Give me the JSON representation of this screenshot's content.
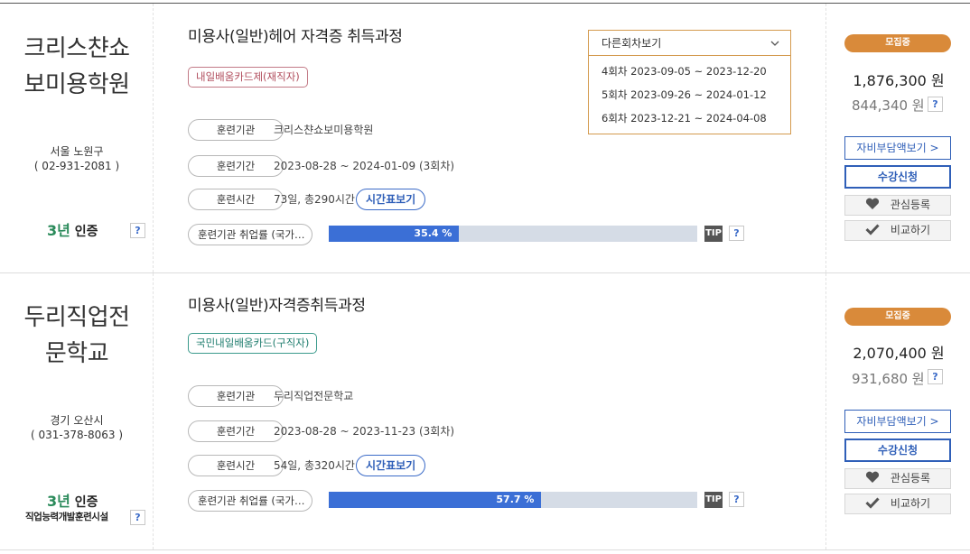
{
  "courses": [
    {
      "institution_lines": [
        "크리스챤쇼",
        "보미용학원"
      ],
      "location": "서울 노원구",
      "phone": "( 02-931-2081 )",
      "cert_years": "3년",
      "cert_label": "인증",
      "cert_sub": "",
      "title": "미용사(일반)헤어 자격증 취득과정",
      "card_type": "내일배움카드제(재직자)",
      "labels": {
        "institution": "훈련기관",
        "period": "훈련기간",
        "hours": "훈련시간",
        "employment": "훈련기관 취업률 (국가…"
      },
      "institution_value": "크리스챤쇼보미용학원",
      "period_value": "2023-08-28 ~ 2024-01-09 (3회차)",
      "hours_value": "73일, 총290시간",
      "timetable_button": "시간표보기",
      "employment_rate": 35.4,
      "employment_rate_label": "35.4 %",
      "tip": "TIP",
      "dropdown": {
        "header": "다른회차보기",
        "items": [
          "4회차 2023-09-05 ~ 2023-12-20",
          "5회차 2023-09-26 ~ 2024-01-12",
          "6회차 2023-12-21 ~ 2024-04-08"
        ]
      },
      "status": "모집중",
      "price": "1,876,300 원",
      "price_self": "844,340 원",
      "buttons": {
        "self_pay": "자비부담액보기 >",
        "apply": "수강신청",
        "interest": "관심등록",
        "compare": "비교하기"
      }
    },
    {
      "institution_lines": [
        "두리직업전",
        "문학교"
      ],
      "location": "경기 오산시",
      "phone": "( 031-378-8063 )",
      "cert_years": "3년",
      "cert_label": "인증",
      "cert_sub": "직업능력개발훈련시설",
      "title": "미용사(일반)자격증취득과정",
      "card_type": "국민내일배움카드(구직자)",
      "labels": {
        "institution": "훈련기관",
        "period": "훈련기간",
        "hours": "훈련시간",
        "employment": "훈련기관 취업률 (국가…"
      },
      "institution_value": "두리직업전문학교",
      "period_value": "2023-08-28 ~ 2023-11-23 (3회차)",
      "hours_value": "54일, 총320시간",
      "timetable_button": "시간표보기",
      "employment_rate": 57.7,
      "employment_rate_label": "57.7 %",
      "tip": "TIP",
      "status": "모집중",
      "price": "2,070,400 원",
      "price_self": "931,680 원",
      "buttons": {
        "self_pay": "자비부담액보기 >",
        "apply": "수강신청",
        "interest": "관심등록",
        "compare": "비교하기"
      }
    }
  ],
  "help_glyph": "?",
  "icons": {
    "dropdown_chevron": "chevron-down-icon",
    "interest": "heart-icon",
    "compare": "check-icon"
  },
  "colors": {
    "accent_blue": "#3b6fd6",
    "status_orange": "#d98a3a",
    "dropdown_border": "#d49a4e"
  }
}
